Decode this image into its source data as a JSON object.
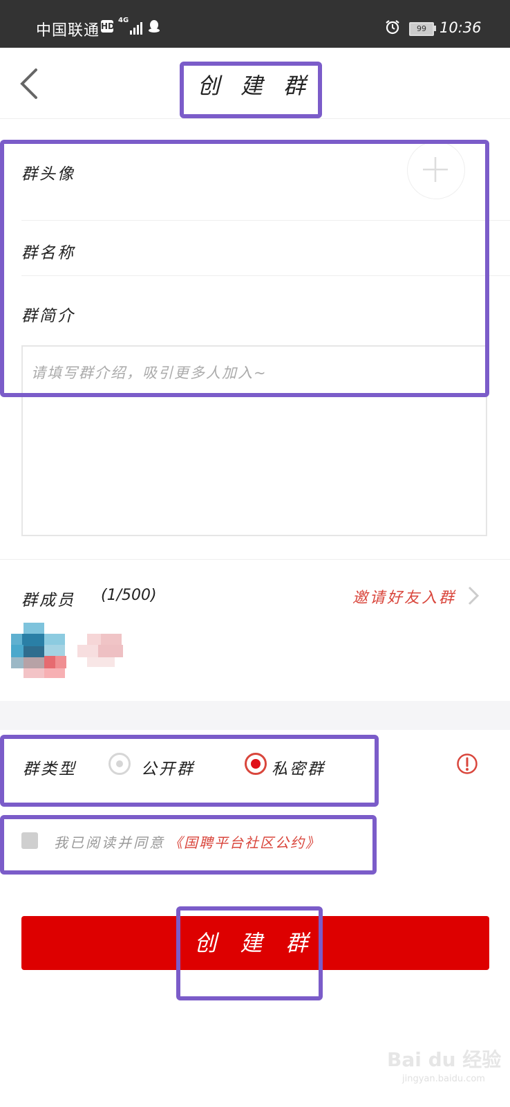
{
  "status_bar": {
    "carrier": "中国联通",
    "hd_badge": "HD",
    "network": "4G",
    "battery": "99",
    "time": "10:36"
  },
  "header": {
    "title": "创 建 群",
    "back_icon": "chevron-left-icon"
  },
  "form": {
    "avatar_label": "群头像",
    "avatar_add_icon": "plus-icon",
    "name_label": "群名称",
    "intro_label": "群简介",
    "intro_placeholder": "请填写群介绍，吸引更多人加入~"
  },
  "members": {
    "label": "群成员",
    "count": "(1/500)",
    "invite_label": "邀请好友入群",
    "invite_icon": "chevron-right-icon"
  },
  "group_type": {
    "label": "群类型",
    "options": [
      {
        "label": "公开群",
        "selected": false
      },
      {
        "label": "私密群",
        "selected": true
      }
    ],
    "info_icon": "exclamation-circle-icon"
  },
  "agreement": {
    "text": "我已阅读并同意",
    "link": "《国聘平台社区公约》",
    "checked": false
  },
  "submit": {
    "label": "创 建 群"
  },
  "colors": {
    "accent": "#d9463c",
    "button": "#dd0000",
    "highlight": "#7b5cc9"
  },
  "watermark": {
    "brand": "Bai du 经验",
    "url": "jingyan.baidu.com"
  }
}
